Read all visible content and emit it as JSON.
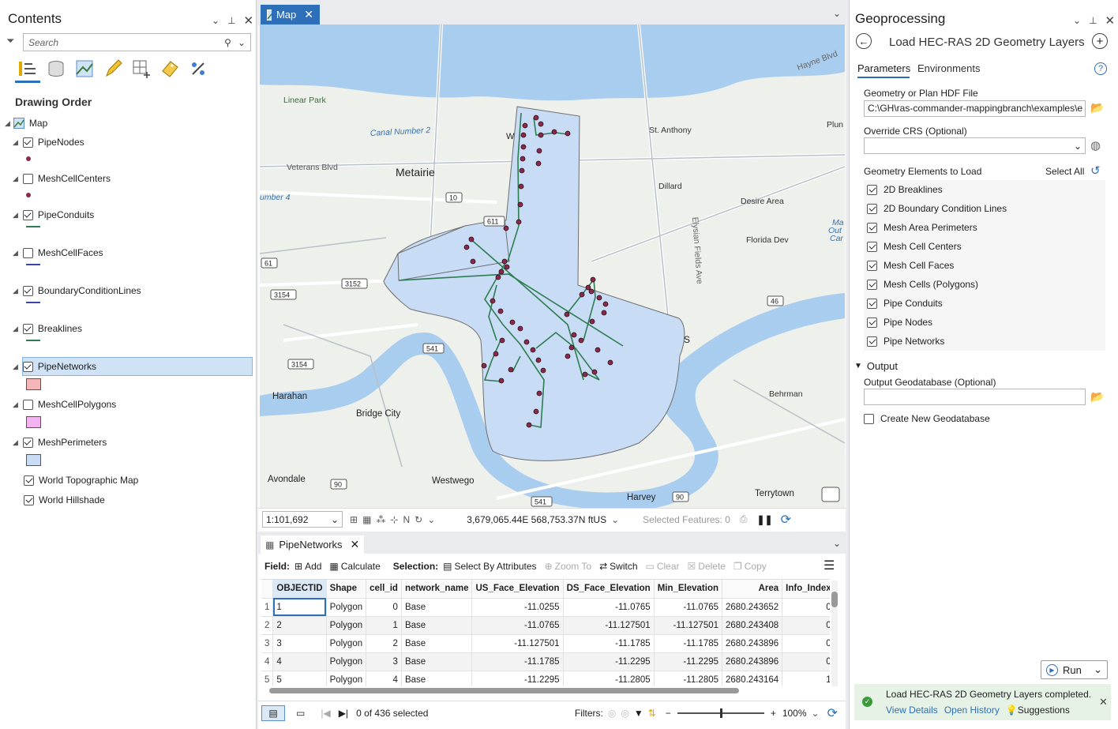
{
  "contents": {
    "title": "Contents",
    "search_placeholder": "Search",
    "section": "Drawing Order",
    "map_label": "Map",
    "layers": [
      {
        "name": "PipeNodes",
        "checked": true
      },
      {
        "name": "MeshCellCenters",
        "checked": false
      },
      {
        "name": "PipeConduits",
        "checked": true
      },
      {
        "name": "MeshCellFaces",
        "checked": false
      },
      {
        "name": "BoundaryConditionLines",
        "checked": true
      },
      {
        "name": "Breaklines",
        "checked": true
      },
      {
        "name": "PipeNetworks",
        "checked": true
      },
      {
        "name": "MeshCellPolygons",
        "checked": false
      },
      {
        "name": "MeshPerimeters",
        "checked": true
      },
      {
        "name": "World Topographic Map",
        "checked": true
      },
      {
        "name": "World Hillshade",
        "checked": true
      }
    ]
  },
  "map": {
    "tab": "Map",
    "labels": {
      "linear_park": "Linear Park",
      "canal": "Canal Number 2",
      "veterans": "Veterans Blvd",
      "metairie": "Metairie",
      "number4": "umber 4",
      "st_anthony": "St. Anthony",
      "dillard": "Dillard",
      "desire": "Desire Area",
      "florida": "Florida Dev",
      "plum": "Plun",
      "hayne": "Hayne Blvd",
      "elysian": "Elysian Fields Ave",
      "harahan": "Harahan",
      "bridge_city": "Bridge City",
      "behrman": "Behrman",
      "avondale": "Avondale",
      "westwego": "Westwego",
      "harvey": "Harvey",
      "terrytown": "Terrytown",
      "s_label": "S",
      "w_label": "W",
      "ma": "Ma",
      "out": "Out",
      "car": "Car"
    },
    "shields": [
      "10",
      "611",
      "61",
      "3152",
      "3154",
      "541",
      "3154",
      "46",
      "90",
      "541",
      "90"
    ],
    "scale": "1:101,692",
    "coords": "3,679,065.44E 568,753.37N ftUS",
    "selected": "Selected Features: 0"
  },
  "table": {
    "tab": "PipeNetworks",
    "field_label": "Field:",
    "add": "Add",
    "calculate": "Calculate",
    "selection_label": "Selection:",
    "select_by_attr": "Select By Attributes",
    "zoom_to": "Zoom To",
    "switch": "Switch",
    "clear": "Clear",
    "delete": "Delete",
    "copy": "Copy",
    "columns": [
      "OBJECTID",
      "Shape",
      "cell_id",
      "network_name",
      "US_Face_Elevation",
      "DS_Face_Elevation",
      "Min_Elevation",
      "Area",
      "Info_Index"
    ],
    "rows": [
      [
        "1",
        "1",
        "Polygon",
        "0",
        "Base",
        "-11.0255",
        "-11.0765",
        "-11.0765",
        "2680.243652",
        "0"
      ],
      [
        "2",
        "2",
        "Polygon",
        "1",
        "Base",
        "-11.0765",
        "-11.127501",
        "-11.127501",
        "2680.243408",
        "0"
      ],
      [
        "3",
        "3",
        "Polygon",
        "2",
        "Base",
        "-11.127501",
        "-11.1785",
        "-11.1785",
        "2680.243896",
        "0"
      ],
      [
        "4",
        "4",
        "Polygon",
        "3",
        "Base",
        "-11.1785",
        "-11.2295",
        "-11.2295",
        "2680.243896",
        "0"
      ],
      [
        "5",
        "5",
        "Polygon",
        "4",
        "Base",
        "-11.2295",
        "-11.2805",
        "-11.2805",
        "2680.243164",
        "1"
      ]
    ],
    "status": "0 of 436 selected",
    "filters": "Filters:",
    "zoom": "100%"
  },
  "geo": {
    "title": "Geoprocessing",
    "tool": "Load HEC-RAS 2D Geometry Layers",
    "tab_params": "Parameters",
    "tab_env": "Environments",
    "file_label": "Geometry or Plan HDF File",
    "file_value": "C:\\GH\\ras-commander-mappingbranch\\examples\\e",
    "crs_label": "Override CRS (Optional)",
    "elements_label": "Geometry Elements to Load",
    "select_all": "Select All",
    "elements": [
      "2D Breaklines",
      "2D Boundary Condition Lines",
      "Mesh Area Perimeters",
      "Mesh Cell Centers",
      "Mesh Cell Faces",
      "Mesh Cells (Polygons)",
      "Pipe Conduits",
      "Pipe Nodes",
      "Pipe Networks"
    ],
    "output_label": "Output",
    "gdb_label": "Output Geodatabase (Optional)",
    "create_gdb": "Create New Geodatabase",
    "run": "Run",
    "msg": "Load HEC-RAS 2D Geometry Layers completed.",
    "view_details": "View Details",
    "open_history": "Open History",
    "suggestions": "Suggestions"
  },
  "colors": {
    "accent": "#2d6fb8",
    "water": "#a9cdee",
    "land": "#eef0ec",
    "mesh": "#c9dcf5",
    "pipe": "#2e7d52",
    "node": "#8a2a4a"
  }
}
